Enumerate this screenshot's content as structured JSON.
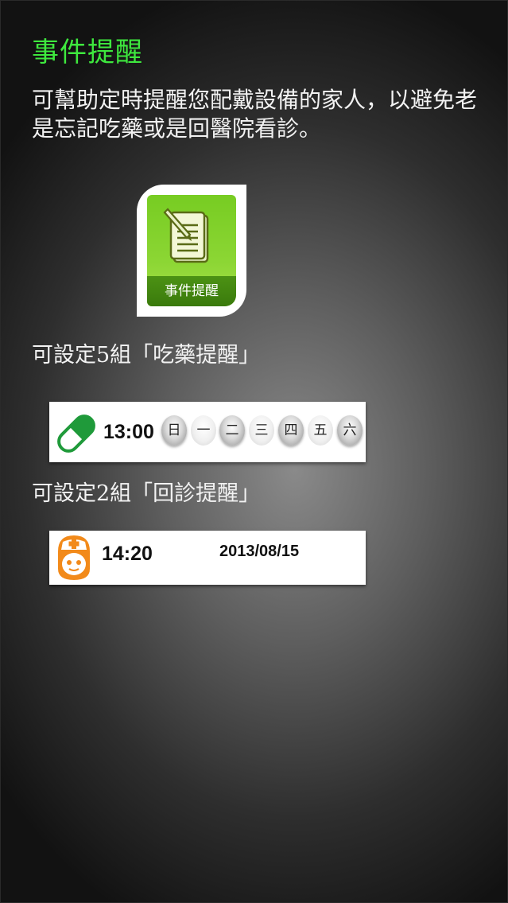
{
  "page": {
    "title": "事件提醒",
    "description": "可幫助定時提醒您配戴設備的家人，以避免老是忘記吃藥或是回醫院看診。"
  },
  "app_icon": {
    "label": "事件提醒",
    "icon": "notepad-pen-icon"
  },
  "medicine": {
    "label": "可設定5組「吃藥提醒」",
    "icon": "pill-icon",
    "time": "13:00",
    "days": [
      {
        "label": "日",
        "selected": true
      },
      {
        "label": "一",
        "selected": false
      },
      {
        "label": "二",
        "selected": true
      },
      {
        "label": "三",
        "selected": false
      },
      {
        "label": "四",
        "selected": true
      },
      {
        "label": "五",
        "selected": false
      },
      {
        "label": "六",
        "selected": true
      }
    ]
  },
  "revisit": {
    "label": "可設定2組「回診提醒」",
    "icon": "nurse-icon",
    "time": "14:20",
    "date": "2013/08/15"
  },
  "colors": {
    "title": "#3ee83e",
    "icon_green": "#8cd634",
    "pill_green": "#1f9a3a",
    "nurse_orange": "#f28a1a"
  }
}
